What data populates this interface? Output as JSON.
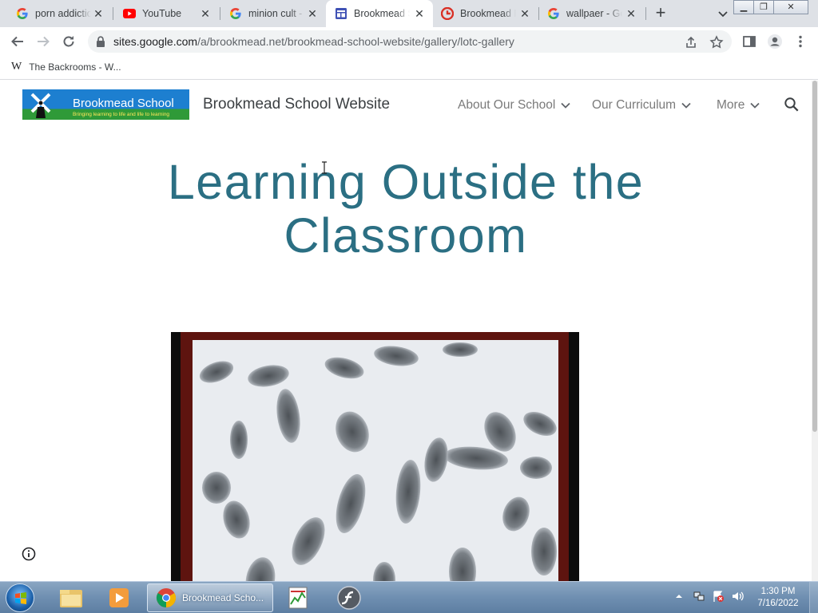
{
  "browser": {
    "tabs": [
      {
        "title": "porn addictio",
        "icon": "google-icon",
        "active": false
      },
      {
        "title": "YouTube",
        "icon": "youtube-icon",
        "active": false
      },
      {
        "title": "minion cult -",
        "icon": "google-icon",
        "active": false
      },
      {
        "title": "Brookmead S",
        "icon": "google-sites-icon",
        "active": true
      },
      {
        "title": "Brookmead N",
        "icon": "red-c-icon",
        "active": false
      },
      {
        "title": "wallpaer - Go",
        "icon": "google-icon",
        "active": false
      }
    ],
    "url_host": "sites.google.com",
    "url_path": "/a/brookmead.net/brookmead-school-website/gallery/lotc-gallery",
    "bookmark": "The Backrooms - W...",
    "bookmark_glyph": "W"
  },
  "site": {
    "logo_name": "Brookmead School",
    "logo_tagline": "Bringing learning to life and life to learning",
    "title": "Brookmead School Website",
    "nav": [
      "About Our School",
      "Our Curriculum",
      "More"
    ],
    "heading_line1": "Learning Outside the",
    "heading_line2": "Classroom"
  },
  "taskbar": {
    "active_window": "Brookmead Scho...",
    "time": "1:30 PM",
    "date": "7/16/2022"
  },
  "colors": {
    "heading": "#2b6f83",
    "nav_text": "#7a7a7a",
    "tab_strip": "#dee1e6",
    "photo_frame": "#5e140f"
  }
}
